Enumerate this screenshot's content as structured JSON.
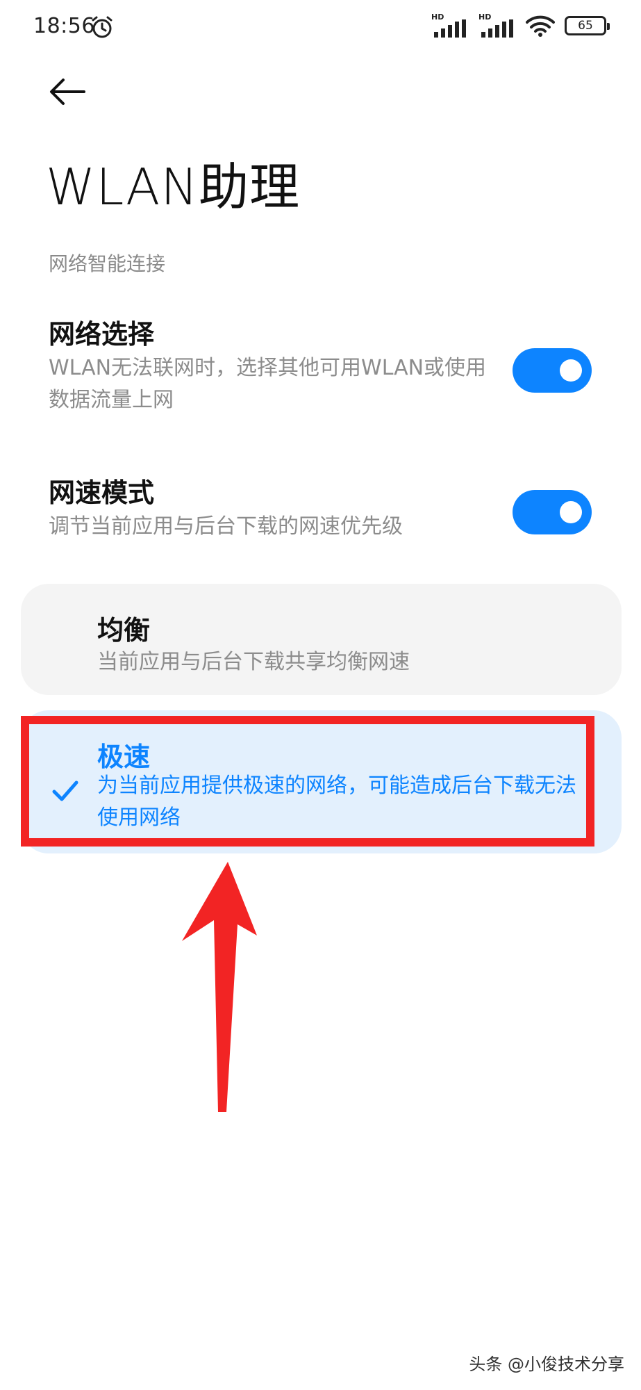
{
  "status_bar": {
    "time": "18:56",
    "signal_1_label": "HD",
    "signal_2_label": "HD",
    "battery_level": "65"
  },
  "header": {
    "title": "WLAN助理"
  },
  "section": {
    "label": "网络智能连接"
  },
  "settings": [
    {
      "title": "网络选择",
      "description": "WLAN无法联网时，选择其他可用WLAN或使用数据流量上网",
      "enabled": true
    },
    {
      "title": "网速模式",
      "description": "调节当前应用与后台下载的网速优先级",
      "enabled": true
    }
  ],
  "speed_modes": [
    {
      "title": "均衡",
      "description": "当前应用与后台下载共享均衡网速",
      "selected": false
    },
    {
      "title": "极速",
      "description": "为当前应用提供极速的网络，可能造成后台下载无法使用网络",
      "selected": true
    }
  ],
  "colors": {
    "accent": "#0d84ff",
    "selected_bg": "#e3f0fd",
    "card_bg": "#f4f4f4",
    "annotation_red": "#f22424"
  },
  "watermark": "头条 @小俊技术分享"
}
